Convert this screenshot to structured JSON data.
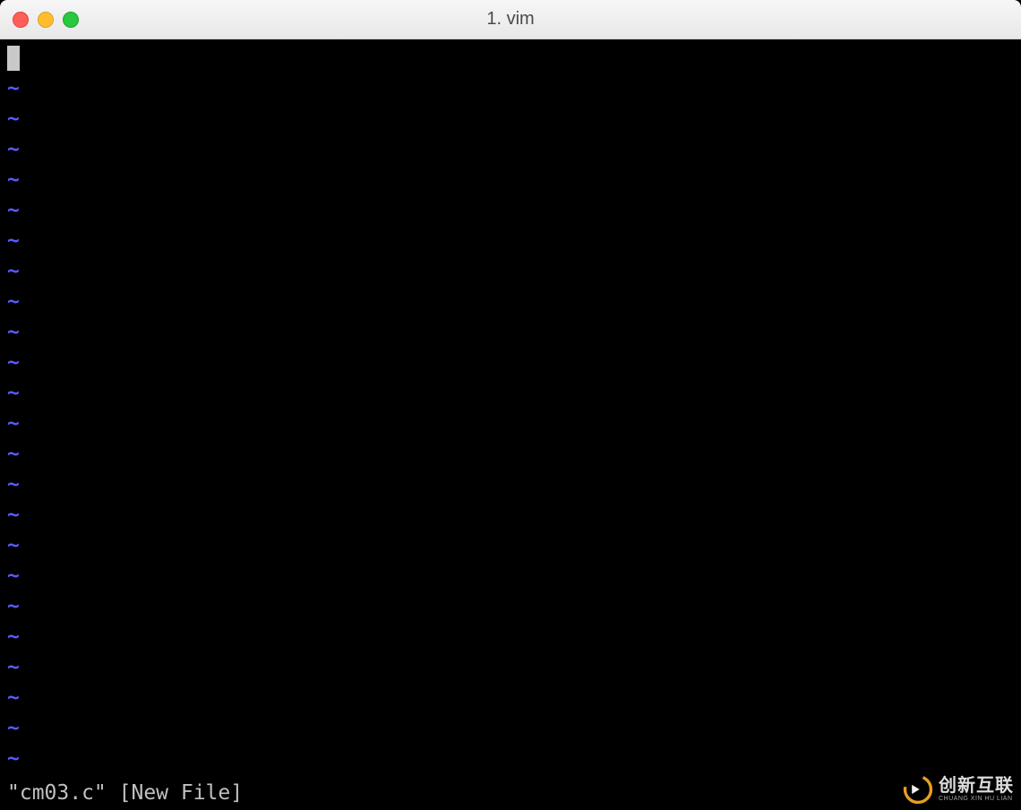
{
  "window": {
    "title": "1. vim"
  },
  "editor": {
    "tilde": "~",
    "tilde_count": 23
  },
  "status": {
    "text": "\"cm03.c\" [New File]"
  },
  "watermark": {
    "main": "创新互联",
    "sub": "CHUANG XIN HU LIAN"
  }
}
